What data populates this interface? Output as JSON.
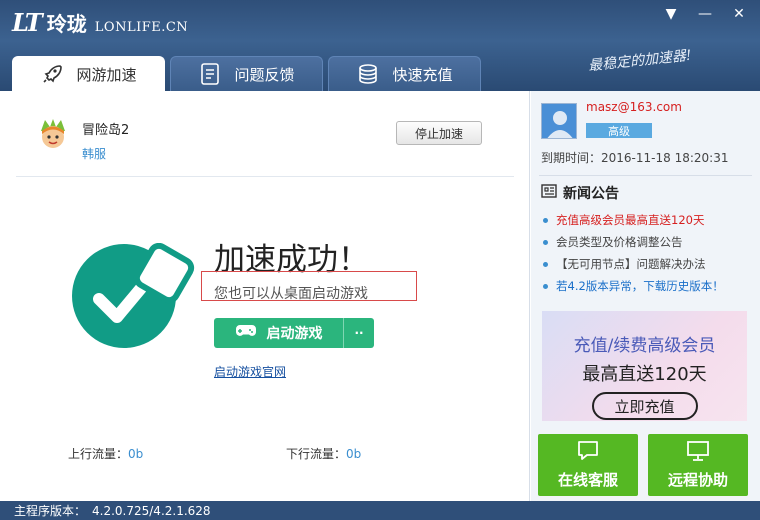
{
  "app": {
    "logo_mark": "LT",
    "logo_cn": "玲珑",
    "logo_en": "LONLIFE.CN",
    "slogan": "最稳定的加速器!"
  },
  "window_controls": {
    "menu": "▼",
    "minimize": "—",
    "close": "✕"
  },
  "tabs": [
    {
      "label": "网游加速",
      "icon": "rocket-icon",
      "active": true
    },
    {
      "label": "问题反馈",
      "icon": "document-icon",
      "active": false
    },
    {
      "label": "快速充值",
      "icon": "coins-icon",
      "active": false
    }
  ],
  "game": {
    "name": "冒险岛2",
    "server": "韩服",
    "stop_label": "停止加速"
  },
  "status": {
    "title": "加速成功！",
    "tip": "您也可以从桌面启动游戏",
    "launch_label": "启动游戏",
    "more_label": "··",
    "site_link": "启动游戏官网"
  },
  "traffic": {
    "up_label": "上行流量：",
    "up_value": "0b",
    "down_label": "下行流量：",
    "down_value": "0b"
  },
  "user": {
    "email": "masz@163.com",
    "level": "高级",
    "expire_label": "到期时间：",
    "expire_value": "2016-11-18 18:20:31"
  },
  "news": {
    "title": "新闻公告",
    "items": [
      {
        "text": "充值高级会员最高直送120天",
        "style": "hot"
      },
      {
        "text": "会员类型及价格调整公告",
        "style": "normal"
      },
      {
        "text": "【无可用节点】问题解决办法",
        "style": "normal"
      },
      {
        "text": "若4.2版本异常，下载历史版本！",
        "style": "blue"
      }
    ]
  },
  "promo": {
    "line1": "充值/续费高级会员",
    "line2": "最高直送120天",
    "button": "立即充值"
  },
  "services": {
    "online": "在线客服",
    "remote": "远程协助"
  },
  "footer": {
    "label": "主程序版本：",
    "version": "4.2.0.725/4.2.1.628"
  },
  "colors": {
    "header": "#3c6290",
    "accent_green": "#2bb57d",
    "service_green": "#55b823",
    "check_teal": "#119c86",
    "alert_red": "#d62020"
  }
}
